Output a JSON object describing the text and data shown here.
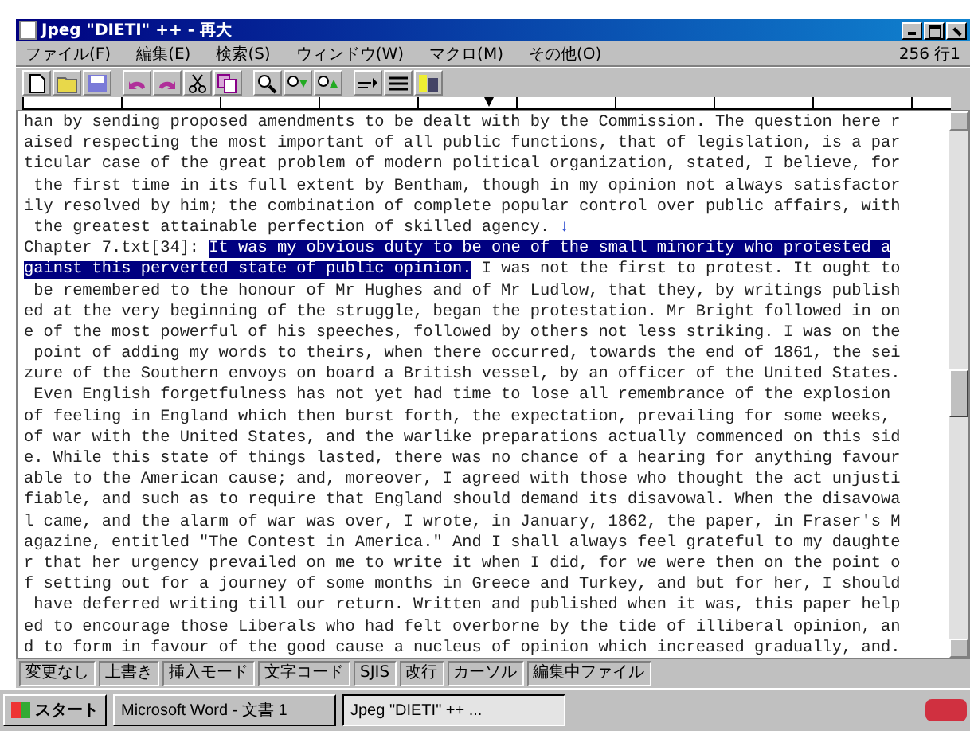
{
  "window": {
    "title": "Jpeg \"DIETI\" ++ - 再大",
    "position": "256 行1"
  },
  "menu": [
    "ファイル(F)",
    "編集(E)",
    "検索(S)",
    "ウィンドウ(W)",
    "マクロ(M)",
    "その他(O)"
  ],
  "editor": {
    "lines": [
      {
        "segments": [
          {
            "text": "han by sending proposed amendments to be dealt with by the Commission. The question here r",
            "selected": false
          }
        ]
      },
      {
        "segments": [
          {
            "text": "aised respecting the most important of all public functions, that of legislation, is a par",
            "selected": false
          }
        ]
      },
      {
        "segments": [
          {
            "text": "ticular case of the great problem of modern political organization, stated, I believe, for",
            "selected": false
          }
        ]
      },
      {
        "segments": [
          {
            "text": " the first time in its full extent by Bentham, though in my opinion not always satisfactor",
            "selected": false
          }
        ]
      },
      {
        "segments": [
          {
            "text": "ily resolved by him; the combination of complete popular control over public affairs, with",
            "selected": false
          }
        ]
      },
      {
        "segments": [
          {
            "text": " the greatest attainable perfection of skilled agency.",
            "selected": false
          }
        ],
        "eol_mark": "↓"
      },
      {
        "segments": [
          {
            "text": "Chapter 7.txt[34]: ",
            "selected": false
          },
          {
            "text": "It was my obvious duty to be one of the small minority who protested a",
            "selected": true
          }
        ]
      },
      {
        "segments": [
          {
            "text": "gainst this perverted state of public opinion.",
            "selected": true
          },
          {
            "text": " I was not the first to protest. It ought to",
            "selected": false
          }
        ]
      },
      {
        "segments": [
          {
            "text": " be remembered to the honour of Mr Hughes and of Mr Ludlow, that they, by writings publish",
            "selected": false
          }
        ]
      },
      {
        "segments": [
          {
            "text": "ed at the very beginning of the struggle, began the protestation. Mr Bright followed in on",
            "selected": false
          }
        ]
      },
      {
        "segments": [
          {
            "text": "e of the most powerful of his speeches, followed by others not less striking. I was on the",
            "selected": false
          }
        ]
      },
      {
        "segments": [
          {
            "text": " point of adding my words to theirs, when there occurred, towards the end of 1861, the sei",
            "selected": false
          }
        ]
      },
      {
        "segments": [
          {
            "text": "zure of the Southern envoys on board a British vessel, by an officer of the United States.",
            "selected": false
          }
        ]
      },
      {
        "segments": [
          {
            "text": " Even English forgetfulness has not yet had time to lose all remembrance of the explosion",
            "selected": false
          }
        ]
      },
      {
        "segments": [
          {
            "text": "of feeling in England which then burst forth, the expectation, prevailing for some weeks,",
            "selected": false
          }
        ]
      },
      {
        "segments": [
          {
            "text": "of war with the United States, and the warlike preparations actually commenced on this sid",
            "selected": false
          }
        ]
      },
      {
        "segments": [
          {
            "text": "e. While this state of things lasted, there was no chance of a hearing for anything favour",
            "selected": false
          }
        ]
      },
      {
        "segments": [
          {
            "text": "able to the American cause; and, moreover, I agreed with those who thought the act unjusti",
            "selected": false
          }
        ]
      },
      {
        "segments": [
          {
            "text": "fiable, and such as to require that England should demand its disavowal. When the disavowa",
            "selected": false
          }
        ]
      },
      {
        "segments": [
          {
            "text": "l came, and the alarm of war was over, I wrote, in January, 1862, the paper, in Fraser's M",
            "selected": false
          }
        ]
      },
      {
        "segments": [
          {
            "text": "agazine, entitled \"The Contest in America.\" And I shall always feel grateful to my daughte",
            "selected": false
          }
        ]
      },
      {
        "segments": [
          {
            "text": "r that her urgency prevailed on me to write it when I did, for we were then on the point o",
            "selected": false
          }
        ]
      },
      {
        "segments": [
          {
            "text": "f setting out for a journey of some months in Greece and Turkey, and but for her, I should",
            "selected": false
          }
        ]
      },
      {
        "segments": [
          {
            "text": " have deferred writing till our return. Written and published when it was, this paper help",
            "selected": false
          }
        ]
      },
      {
        "segments": [
          {
            "text": "ed to encourage those Liberals who had felt overborne by the tide of illiberal opinion, an",
            "selected": false
          }
        ]
      },
      {
        "segments": [
          {
            "text": "d to form in favour of the good cause a nucleus of opinion which increased gradually, and.",
            "selected": false
          }
        ]
      }
    ]
  },
  "status_bar": [
    "変更なし",
    "上書き",
    "挿入モード",
    "文字コード",
    "SJIS",
    "改行",
    "カーソル",
    "編集中ファイル"
  ],
  "taskbar": {
    "start": "スタート",
    "tasks": [
      {
        "label": "Microsoft Word - 文書 1",
        "selected": false
      },
      {
        "label": "Jpeg \"DIETI\" ++ ...",
        "selected": true
      }
    ]
  }
}
